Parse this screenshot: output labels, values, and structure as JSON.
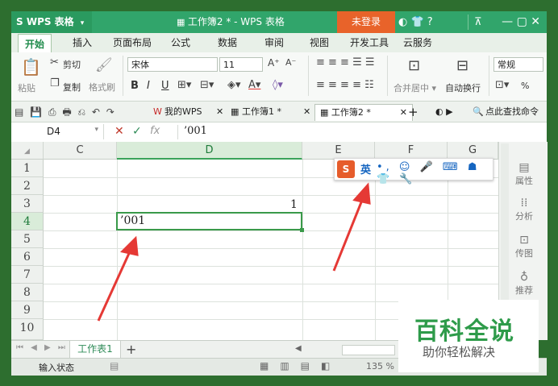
{
  "window": {
    "app_name": "WPS 表格",
    "doc_title": "工作簿2 * - WPS 表格",
    "login_button": "未登录",
    "toolbar_icons": "◐ 👕 ? ",
    "window_controls": "—  ▢  ✕"
  },
  "menu": {
    "tabs": [
      "开始",
      "插入",
      "页面布局",
      "公式",
      "数据",
      "审阅",
      "视图",
      "开发工具",
      "云服务"
    ]
  },
  "ribbon": {
    "paste": "粘贴",
    "cut": "剪切",
    "copy": "复制",
    "format_painter": "格式刷",
    "font_name": "宋体",
    "font_size": "11",
    "bold": "B",
    "italic": "I",
    "underline": "U",
    "merge_center": "合并居中",
    "wrap_text": "自动换行",
    "number_format": "常规",
    "percent": "%"
  },
  "doc_tabs": {
    "my_wps": "我的WPS",
    "workbook1": "工作簿1 *",
    "workbook2": "工作簿2 *",
    "add": "+",
    "search": "点此查找命令"
  },
  "formula_bar": {
    "cell_ref": "D4",
    "fx": "fx",
    "content": "’001"
  },
  "grid": {
    "columns": [
      "C",
      "D",
      "E",
      "F",
      "G"
    ],
    "rows": [
      "1",
      "2",
      "3",
      "4",
      "5",
      "6",
      "7",
      "8",
      "9",
      "10"
    ],
    "selected_cell_value": "’001",
    "e3_value": "1"
  },
  "ime": {
    "mode": "英"
  },
  "side_panel": {
    "items": [
      "属性",
      "分析",
      "传图",
      "推荐"
    ]
  },
  "sheet_bar": {
    "sheet_name": "工作表1",
    "add": "+"
  },
  "status_bar": {
    "mode": "输入状态",
    "zoom": "135 %"
  },
  "watermark": {
    "title": "百科全说",
    "subtitle": "助你轻松解决"
  },
  "colors": {
    "brand_green": "#31a56b",
    "login_orange": "#e8632a",
    "annotation_red": "#e53935"
  }
}
